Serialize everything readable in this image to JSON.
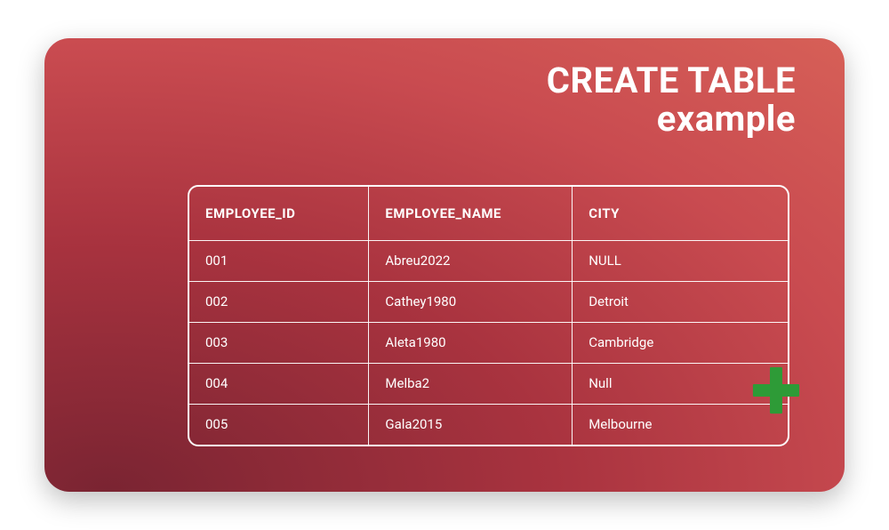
{
  "title": {
    "line1": "CREATE TABLE",
    "line2": "example"
  },
  "table": {
    "headers": [
      "EMPLOYEE_ID",
      "EMPLOYEE_NAME",
      "CITY"
    ],
    "rows": [
      [
        "001",
        "Abreu2022",
        "NULL"
      ],
      [
        "002",
        "Cathey1980",
        "Detroit"
      ],
      [
        "003",
        "Aleta1980",
        "Cambridge"
      ],
      [
        "004",
        "Melba2",
        "Null"
      ],
      [
        "005",
        "Gala2015",
        "Melbourne"
      ]
    ]
  },
  "icons": {
    "plus_color": "#2e9b37"
  },
  "chart_data": {
    "type": "table",
    "title": "CREATE TABLE example",
    "columns": [
      "EMPLOYEE_ID",
      "EMPLOYEE_NAME",
      "CITY"
    ],
    "rows": [
      {
        "EMPLOYEE_ID": "001",
        "EMPLOYEE_NAME": "Abreu2022",
        "CITY": "NULL"
      },
      {
        "EMPLOYEE_ID": "002",
        "EMPLOYEE_NAME": "Cathey1980",
        "CITY": "Detroit"
      },
      {
        "EMPLOYEE_ID": "003",
        "EMPLOYEE_NAME": "Aleta1980",
        "CITY": "Cambridge"
      },
      {
        "EMPLOYEE_ID": "004",
        "EMPLOYEE_NAME": "Melba2",
        "CITY": "Null"
      },
      {
        "EMPLOYEE_ID": "005",
        "EMPLOYEE_NAME": "Gala2015",
        "CITY": "Melbourne"
      }
    ]
  }
}
